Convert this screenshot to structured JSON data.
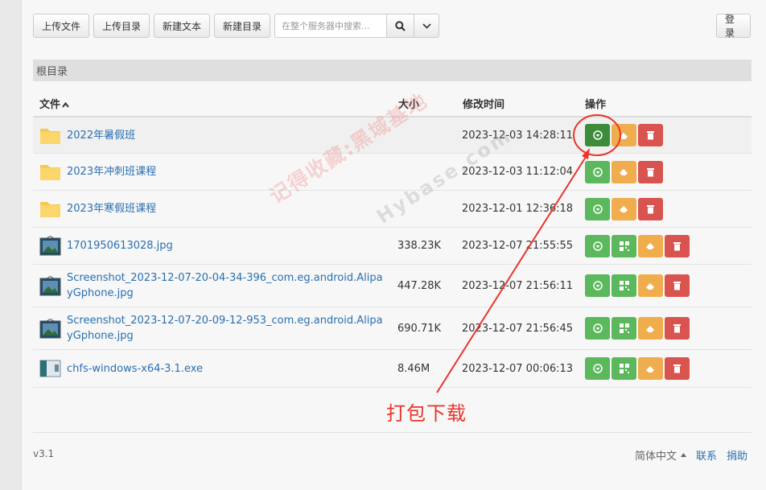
{
  "toolbar": {
    "upload_file": "上传文件",
    "upload_dir": "上传目录",
    "new_text": "新建文本",
    "new_dir": "新建目录",
    "search_placeholder": "在整个服务器中搜索...",
    "login": "登录"
  },
  "breadcrumb": "根目录",
  "table": {
    "headers": {
      "name": "文件",
      "sort_glyph": "^",
      "size": "大小",
      "mtime": "修改时间",
      "ops": "操作"
    },
    "rows": [
      {
        "type": "folder",
        "name": "2022年暑假班",
        "size": "",
        "mtime": "2023-12-03 14:28:11"
      },
      {
        "type": "folder",
        "name": "2023年冲刺班课程",
        "size": "",
        "mtime": "2023-12-03 11:12:04"
      },
      {
        "type": "folder",
        "name": "2023年寒假班课程",
        "size": "",
        "mtime": "2023-12-01 12:36:18"
      },
      {
        "type": "image",
        "name": "1701950613028.jpg",
        "size": "338.23K",
        "mtime": "2023-12-07 21:55:55"
      },
      {
        "type": "image",
        "name": "Screenshot_2023-12-07-20-04-34-396_com.eg.android.AlipayGphone.jpg",
        "size": "447.28K",
        "mtime": "2023-12-07 21:56:11"
      },
      {
        "type": "image",
        "name": "Screenshot_2023-12-07-20-09-12-953_com.eg.android.AlipayGphone.jpg",
        "size": "690.71K",
        "mtime": "2023-12-07 21:56:45"
      },
      {
        "type": "exe",
        "name": "chfs-windows-x64-3.1.exe",
        "size": "8.46M",
        "mtime": "2023-12-07 00:06:13"
      }
    ]
  },
  "footer": {
    "version": "v3.1",
    "language": "简体中文",
    "contact": "联系",
    "donate": "捐助"
  },
  "overlay": {
    "watermark": "记得收藏:黑域基地",
    "watermark2": "Hybase.com",
    "annotation": "打包下载"
  },
  "colors": {
    "download": "#5cb85c",
    "download_active": "#3c8c3c",
    "edit": "#f0ad4e",
    "delete": "#d9534f",
    "link": "#2a6fb1",
    "annotation": "#e8352b"
  },
  "icons": {
    "download": "circle-arrow-down-icon",
    "qrcode": "qrcode-icon",
    "edit": "eraser-icon",
    "delete": "trash-icon",
    "search": "search-icon",
    "dropdown": "chevron-down-icon"
  }
}
